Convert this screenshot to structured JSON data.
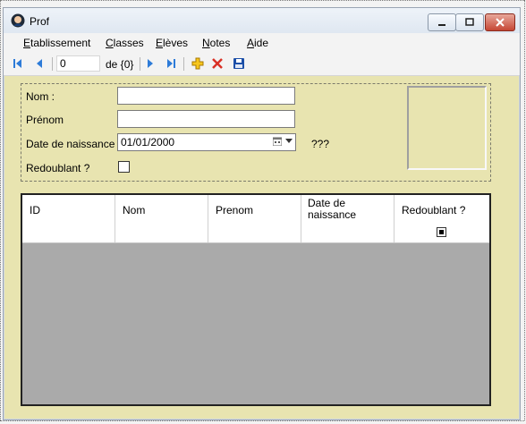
{
  "window": {
    "title": "Prof"
  },
  "menu": {
    "items": [
      "Etablissement",
      "Classes",
      "Elèves",
      "Notes",
      "Aide"
    ]
  },
  "toolbar": {
    "position": "0",
    "of_label": "de {0}"
  },
  "form": {
    "nom_label": "Nom :",
    "prenom_label": "Prénom",
    "date_label": "Date de naissance",
    "date_value": "01/01/2000",
    "unknown_text": "???",
    "redoublant_label": "Redoublant ?"
  },
  "grid": {
    "headers": [
      "ID",
      "Nom",
      "Prenom",
      "Date de\nnaissance",
      "Redoublant ?"
    ]
  },
  "colors": {
    "background": "#e8e4b0",
    "grid_empty": "#aaaaaa",
    "accent": "#2d7bd8"
  }
}
